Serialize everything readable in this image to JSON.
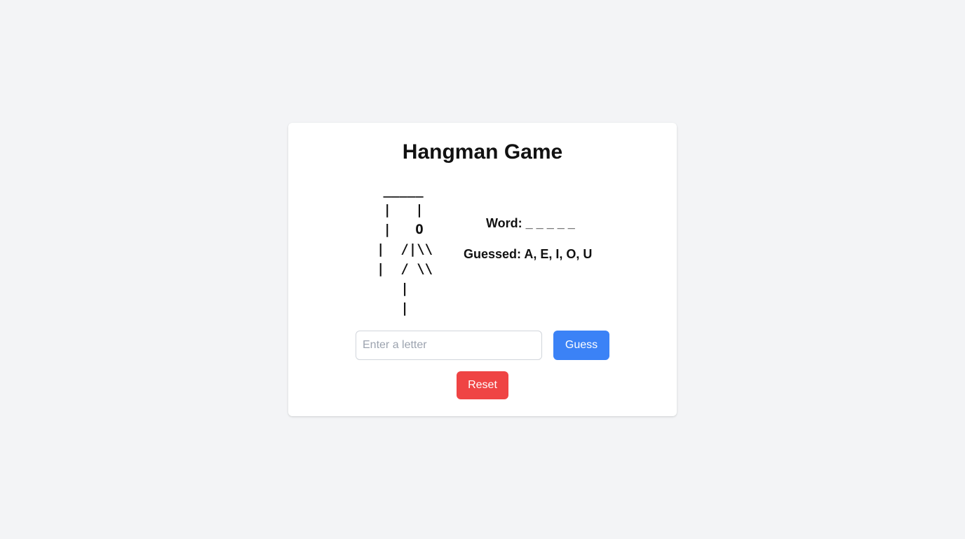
{
  "game": {
    "title": "Hangman Game",
    "hangman_lines": [
      " _____",
      " |   |",
      " |   O",
      "|  /|\\\\",
      "|  / \\\\",
      "   |",
      "   |"
    ],
    "word": {
      "label": "Word:",
      "display": "_ _ _ _ _"
    },
    "guessed": {
      "label": "Guessed:",
      "letters": "A, E, I, O, U"
    },
    "input": {
      "placeholder": "Enter a letter",
      "value": ""
    },
    "guess_button": "Guess",
    "reset_button": "Reset"
  },
  "colors": {
    "page_background": "#f3f4f6",
    "card_background": "#ffffff",
    "guess_button": "#3b82f6",
    "reset_button": "#ef4444",
    "text": "#111111"
  }
}
